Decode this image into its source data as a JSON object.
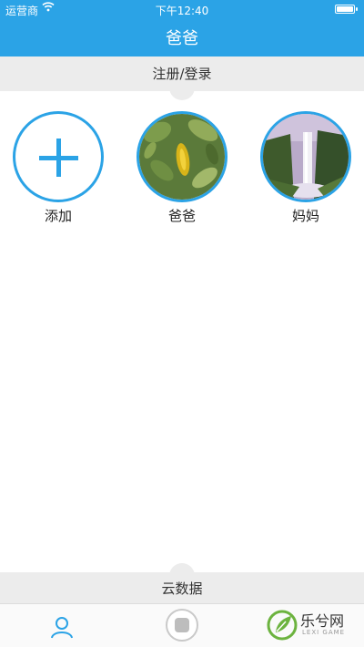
{
  "status_bar": {
    "carrier": "运营商",
    "time": "下午12:40"
  },
  "header": {
    "title": "爸爸"
  },
  "register_bar": {
    "label": "注册/登录"
  },
  "members": [
    {
      "label": "添加",
      "icon": "plus-icon"
    },
    {
      "label": "爸爸",
      "icon": "leaf-photo"
    },
    {
      "label": "妈妈",
      "icon": "waterfall-photo"
    }
  ],
  "cloud_bar": {
    "label": "云数据"
  },
  "tabbar": {
    "items": [
      {
        "icon": "user-icon"
      },
      {
        "icon": "record-button-icon"
      }
    ]
  },
  "watermark": {
    "text": "乐兮网",
    "sub": "LEXI GAME"
  },
  "colors": {
    "accent": "#2ba3e6",
    "bar_gray": "#ececec"
  }
}
